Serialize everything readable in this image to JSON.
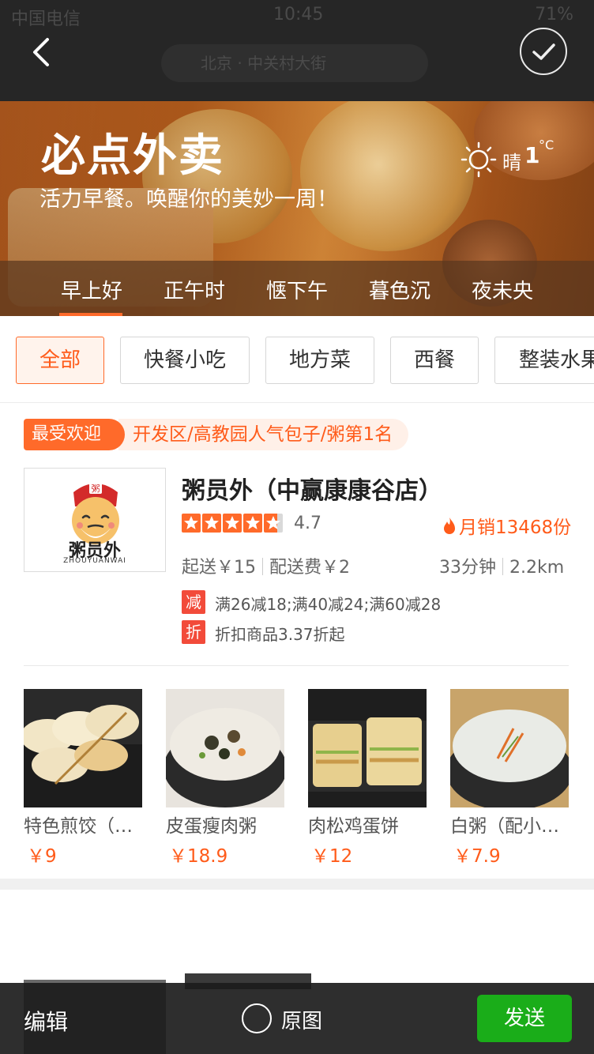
{
  "status_bar": {
    "carrier": "中国电信",
    "time": "10:45",
    "battery": "71%"
  },
  "search": {
    "location": "北京 · 中关村大街"
  },
  "banner": {
    "title": "必点外卖",
    "subtitle": "活力早餐。唤醒你的美妙一周！",
    "weather": {
      "condition": "晴",
      "temp": "1",
      "unit": "°C"
    }
  },
  "time_tabs": [
    "早上好",
    "正午时",
    "惬下午",
    "暮色沉",
    "夜未央"
  ],
  "active_time_tab": 0,
  "filters": [
    "全部",
    "快餐小吃",
    "地方菜",
    "西餐",
    "整装水果"
  ],
  "active_filter": 0,
  "shop": {
    "badge": "最受欢迎",
    "badge_desc": "开发区/高教园人气包子/粥第1名",
    "name": "粥员外（中赢康康谷店）",
    "logo_text": "粥员外",
    "logo_sub": "ZHOUYUANWAI",
    "rating": "4.7",
    "stars": 4.7,
    "monthly_sales": "月销13468份",
    "min_order": "起送￥15",
    "delivery_fee": "配送费￥2",
    "delivery_time": "33分钟",
    "distance": "2.2km",
    "promos": [
      {
        "tag": "减",
        "text": "满26减18;满40减24;满60减28"
      },
      {
        "tag": "折",
        "text": "折扣商品3.37折起"
      }
    ],
    "dishes": [
      {
        "name": "特色煎饺（…",
        "price": "￥9"
      },
      {
        "name": "皮蛋瘦肉粥",
        "price": "￥18.9"
      },
      {
        "name": "肉松鸡蛋饼",
        "price": "￥12"
      },
      {
        "name": "白粥（配小…",
        "price": "￥7.9"
      }
    ]
  },
  "bottom_bar": {
    "edit": "编辑",
    "original": "原图",
    "send": "发送"
  },
  "colors": {
    "accent": "#ff6a2a",
    "send": "#1aad19",
    "promo_tag": "#f24b3a"
  }
}
